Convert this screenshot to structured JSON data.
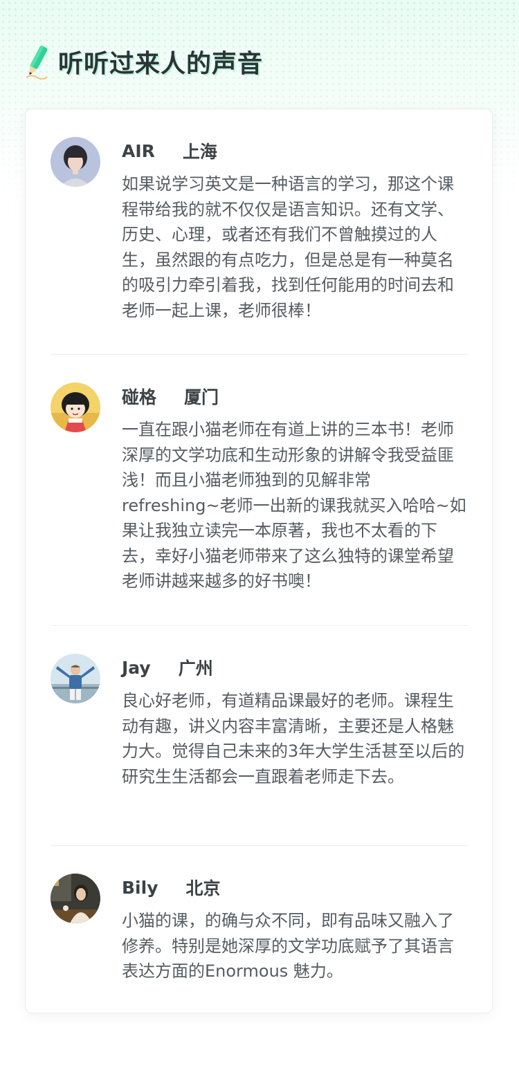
{
  "header": {
    "title": "听听过来人的声音",
    "icon": "pencil-icon",
    "accent": "#2fd29a"
  },
  "reviews": [
    {
      "name": "AIR",
      "city": "上海",
      "text": "如果说学习英文是一种语言的学习，那这个课程带给我的就不仅仅是语言知识。还有文学、历史、心理，或者还有我们不曾触摸过的人生，虽然跟的有点吃力，但是总是有一种莫名的吸引力牵引着我，找到任何能用的时间去和老师一起上课，老师很棒！"
    },
    {
      "name": "碰格",
      "city": "厦门",
      "text": "一直在跟小猫老师在有道上讲的三本书！老师深厚的文学功底和生动形象的讲解令我受益匪浅！而且小猫老师独到的见解非常refreshing~老师一出新的课我就买入哈哈~如果让我独立读完一本原著，我也不太看的下去，幸好小猫老师带来了这么独特的课堂希望老师讲越来越多的好书噢！"
    },
    {
      "name": "Jay",
      "city": "广州",
      "text": "良心好老师，有道精品课最好的老师。课程生动有趣，讲义内容丰富清晰，主要还是人格魅力大。觉得自己未来的3年大学生活甚至以后的研究生生活都会一直跟着老师走下去。"
    },
    {
      "name": "Bily",
      "city": "北京",
      "text": "小猫的课，的确与众不同，即有品味又融入了修养。特别是她深厚的文学功底赋予了其语言表达方面的Enormous 魅力。"
    }
  ]
}
